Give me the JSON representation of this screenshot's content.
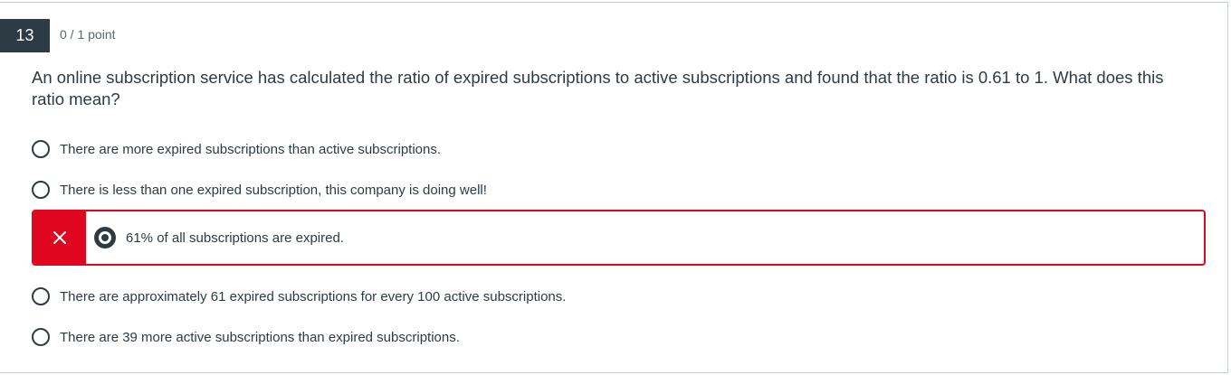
{
  "question": {
    "number": "13",
    "points": "0 / 1 point",
    "text": "An online subscription service has calculated the ratio of expired subscriptions to active subscriptions and found that the ratio is 0.61 to 1.  What does this ratio mean?"
  },
  "answers": [
    {
      "label": "There are more expired subscriptions than active subscriptions.",
      "selected": false
    },
    {
      "label": "There is less than one expired subscription, this company is doing well!",
      "selected": false
    },
    {
      "label": "61% of all subscriptions are expired.",
      "selected": true,
      "status": "incorrect"
    },
    {
      "label": "There are approximately 61 expired subscriptions for every 100 active subscriptions.",
      "selected": false
    },
    {
      "label": "There are 39 more active subscriptions than expired subscriptions.",
      "selected": false
    }
  ],
  "icons": {
    "incorrect": "close-icon"
  },
  "colors": {
    "question_number_bg": "#2d3b45",
    "incorrect": "#e0061f",
    "text": "#2d3b45"
  }
}
